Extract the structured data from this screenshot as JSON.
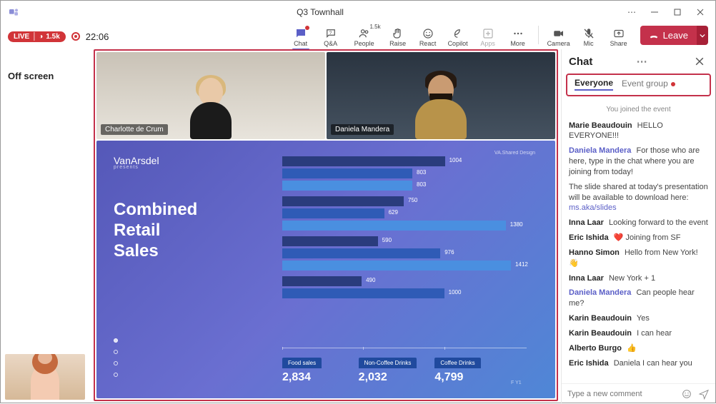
{
  "window": {
    "title": "Q3 Townhall"
  },
  "status": {
    "live_text": "LIVE",
    "viewer_count": "1.5k",
    "timer": "22:06"
  },
  "toolbar": {
    "chat": "Chat",
    "qa": "Q&A",
    "people": "People",
    "people_count": "1.5k",
    "raise": "Raise",
    "react": "React",
    "copilot": "Copilot",
    "apps": "Apps",
    "more": "More",
    "camera": "Camera",
    "mic": "Mic",
    "share": "Share",
    "leave": "Leave"
  },
  "left": {
    "off_screen": "Off screen"
  },
  "participants": [
    {
      "name": "Charlotte de Crum"
    },
    {
      "name": "Daniela Mandera"
    }
  ],
  "slide": {
    "logo": "VanArsdel",
    "logo_sub": "presents",
    "title_line1": "Combined",
    "title_line2": "Retail",
    "title_line3": "Sales",
    "va_tag": "VA.Shared Design",
    "totals": [
      {
        "label": "Food sales",
        "value": "2,834"
      },
      {
        "label": "Non-Coffee Drinks",
        "value": "2,032"
      },
      {
        "label": "Coffee Drinks",
        "value": "4,799"
      }
    ],
    "axis_ticks": [
      "0",
      "500",
      "1000"
    ],
    "ft": "F Y1"
  },
  "chart_data": {
    "type": "bar",
    "orientation": "horizontal",
    "title": "Combined Retail Sales",
    "series": [
      {
        "name": "Food sales",
        "color": "#2a3c7d",
        "values": [
          1004,
          750,
          590,
          490
        ]
      },
      {
        "name": "Non-Coffee Drinks",
        "color": "#2f5bb6",
        "values": [
          803,
          629,
          976,
          1000
        ]
      },
      {
        "name": "Coffee Drinks",
        "color": "#4a8fe0",
        "values": [
          803,
          1380,
          1412,
          null
        ]
      }
    ],
    "groups": 4,
    "xlim": [
      0,
      1500
    ],
    "xticks": [
      0,
      500,
      1000
    ]
  },
  "chat": {
    "header": "Chat",
    "tab_everyone": "Everyone",
    "tab_eventgroup": "Event group",
    "system_joined": "You joined the event",
    "messages": [
      {
        "name": "Marie Beaudouin",
        "text": "HELLO EVERYONE!!!"
      },
      {
        "name": "Daniela Mandera",
        "link": true,
        "text": "For those who are here, type in the chat where you are joining from today!"
      },
      {
        "text_prefix": "The slide shared at today's presentation will be available to download here: ",
        "link_text": "ms.aka/slides"
      },
      {
        "name": "Inna Laar",
        "text": "Looking forward to the event"
      },
      {
        "name": "Eric Ishida",
        "emoji": "❤️",
        "text": "Joining from SF"
      },
      {
        "name": "Hanno Simon",
        "text": "Hello from New York!",
        "trail_emoji": "👋"
      },
      {
        "name": "Inna Laar",
        "text": "New York + 1"
      },
      {
        "name": "Daniela Mandera",
        "link": true,
        "text": "Can people hear me?"
      },
      {
        "name": "Karin Beaudouin",
        "text": "Yes"
      },
      {
        "name": "Karin Beaudouin",
        "text": "I can hear"
      },
      {
        "name": "Alberto Burgo",
        "emoji": "👍",
        "text": ""
      },
      {
        "name": "Eric Ishida",
        "text": "Daniela I can hear you"
      }
    ],
    "composer_placeholder": "Type a new comment"
  }
}
